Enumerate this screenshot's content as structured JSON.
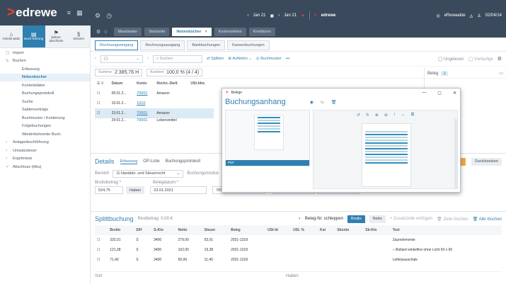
{
  "app": {
    "brand": "edrewe"
  },
  "topbar": {
    "date_from": "Jan 21",
    "date_to": "Jan 21",
    "user": "eRewaakte",
    "time": "02/04/14"
  },
  "rail": {
    "tabs": [
      {
        "label": "Arbeits-platz"
      },
      {
        "label": "Buch-führung"
      },
      {
        "label": "Jahres-abschluss"
      },
      {
        "label": "Steuern"
      }
    ],
    "nav": [
      {
        "label": "Import",
        "type": "top",
        "icon": "file-icon"
      },
      {
        "label": "Buchen",
        "type": "top",
        "icon": "pen-icon"
      },
      {
        "label": "Erfassung",
        "type": "sub"
      },
      {
        "label": "Nebenbücher",
        "type": "sub",
        "active": true
      },
      {
        "label": "Kontenblätter",
        "type": "sub"
      },
      {
        "label": "Buchungsprotokoll",
        "type": "sub"
      },
      {
        "label": "Suche",
        "type": "sub"
      },
      {
        "label": "Saldenvorträge",
        "type": "sub"
      },
      {
        "label": "Buchmuster / Kontierung",
        "type": "sub"
      },
      {
        "label": "Folgebuchungen",
        "type": "sub"
      },
      {
        "label": "Wiederkehrende Buch.",
        "type": "sub"
      },
      {
        "label": "Anlagenbuchführung",
        "type": "top",
        "icon": "chevron-right-icon"
      },
      {
        "label": "Umsatzsteuer",
        "type": "top",
        "icon": "chevron-right-icon"
      },
      {
        "label": "Ergebnisse",
        "type": "top",
        "icon": "chevron-right-icon"
      },
      {
        "label": "Abschluss (Hbu)",
        "type": "top",
        "icon": "check-icon"
      }
    ]
  },
  "main": {
    "tabs": [
      "Mandanten",
      "Startseite",
      "Nebenbücher",
      "Kostenstellen",
      "Kreditoren"
    ],
    "active_tab": "Nebenbücher",
    "subtabs": [
      "Rechnungseingang",
      "Rechnungsausgang",
      "Bankbuchungen",
      "Kassenbuchungen"
    ],
    "toolbar": {
      "search_placeholder": "Suchen",
      "splitten": "Splitten",
      "buchen": "Aufteilen",
      "buchmuster": "Buchmuster",
      "ungelesen": "Ungelesen",
      "vorlaeufige": "Vorläufige",
      "beleg_label": "Beleg",
      "beleg_count": "1"
    },
    "summary": {
      "summe_label": "Summe",
      "summe_value": "2.385,76 H",
      "kontiert_label": "Kontiert",
      "kontiert_value": "100,0 % (4 / 4)"
    },
    "table": {
      "columns": [
        "Datum",
        "Konto",
        "Rechn.-Stell.",
        "USt-Idnr."
      ],
      "rows": [
        {
          "date": "05.01.2...",
          "konto": "70001",
          "name": "Amazon",
          "sel": false
        },
        {
          "date": "15.01.2...",
          "konto": "1610",
          "name": "",
          "sel": false
        },
        {
          "date": "23.01.2...",
          "konto": "70001",
          "name": "Amazon",
          "sel": true
        },
        {
          "date": "24.01.2...",
          "konto": "70001",
          "name": "Lebensmittel",
          "sel": false
        }
      ]
    },
    "details": {
      "title": "Details",
      "tabs": [
        "Erfassung",
        "OP-Liste",
        "Buchungsprotokoll"
      ],
      "bereich_label": "Bereich",
      "bereich_value": "Handels- und Steuerrecht",
      "buchungsmodus": "Buchungsmodus",
      "bruttobetrag_label": "Bruttobetrag *",
      "bruttobetrag_value": "524,75",
      "haben": "Haben",
      "belegdatum_label": "Belegdatum *",
      "belegdatum_value": "23.01.2021",
      "konto_value": "70001",
      "zurueck_button": "Zurücksetzen"
    },
    "split": {
      "title": "Splittbuchung",
      "restbetrag": "Restbetrag: 0,00 €",
      "toggle_label": "Beleg-Nr. schleppen",
      "brutto": "Brutto",
      "netto": "Netto",
      "zeile": "Zusatzzeile einfügen",
      "zeile_del": "Zeile löschen",
      "alle": "Alle löschen",
      "columns": [
        "Brutto",
        "S/H",
        "G-Kto",
        "Netto",
        "Steuer",
        "Beleg",
        "USt-Id",
        "USt. %",
        "Kst",
        "Skonto",
        "Sk-Kto",
        "Text"
      ],
      "rows": [
        {
          "brutto": "332,01",
          "sh": "S",
          "gkto": "3400",
          "netto": "279,00",
          "steuer": "53,01",
          "beleg": "2021-1318",
          "text": "Zaunelemente"
        },
        {
          "brutto": "121,38",
          "sh": "S",
          "gkto": "3400",
          "netto": "102,00",
          "steuer": "19,38",
          "beleg": "2021-1318",
          "text": "Bollard winkelfrei ohne Licht 60 x 60"
        },
        {
          "brutto": "71,40",
          "sh": "S",
          "gkto": "3400",
          "netto": "60,00",
          "steuer": "11,40",
          "beleg": "2021-1318",
          "text": "Lieferpauschale"
        }
      ],
      "footer_soll": "Soll",
      "footer_haben": "Haben"
    }
  },
  "modal": {
    "window_title": "Belege",
    "heading": "Buchungsanhang",
    "thumb_caption": "PDF"
  }
}
